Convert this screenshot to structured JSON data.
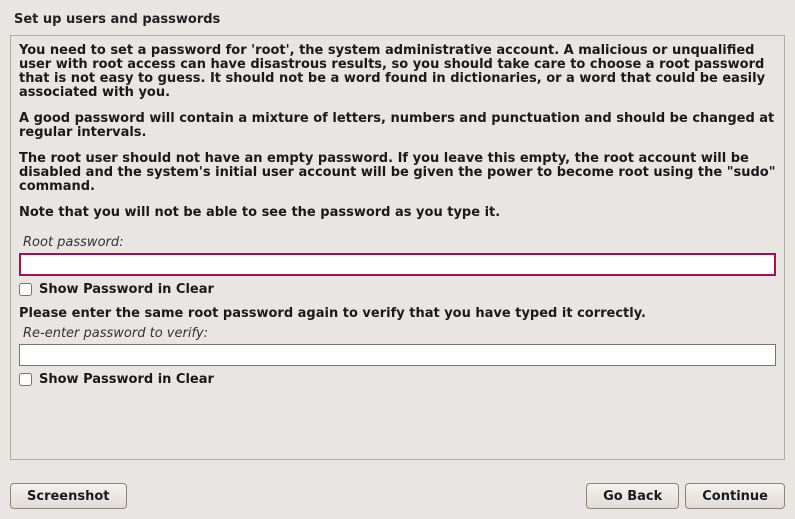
{
  "title": "Set up users and passwords",
  "body": {
    "para1": "You need to set a password for 'root', the system administrative account. A malicious or unqualified user with root access can have disastrous results, so you should take care to choose a root password that is not easy to guess. It should not be a word found in dictionaries, or a word that could be easily associated with you.",
    "para2": "A good password will contain a mixture of letters, numbers and punctuation and should be changed at regular intervals.",
    "para3": "The root user should not have an empty password. If you leave this empty, the root account will be disabled and the system's initial user account will be given the power to become root using the \"sudo\" command.",
    "para4": "Note that you will not be able to see the password as you type it.",
    "root_password_label": "Root password:",
    "root_password_value": "",
    "show_clear_1": "Show Password in Clear",
    "show_clear_1_checked": false,
    "verify_text": "Please enter the same root password again to verify that you have typed it correctly.",
    "verify_label": "Re-enter password to verify:",
    "verify_value": "",
    "show_clear_2": "Show Password in Clear",
    "show_clear_2_checked": false
  },
  "footer": {
    "screenshot": "Screenshot",
    "go_back": "Go Back",
    "continue": "Continue"
  }
}
